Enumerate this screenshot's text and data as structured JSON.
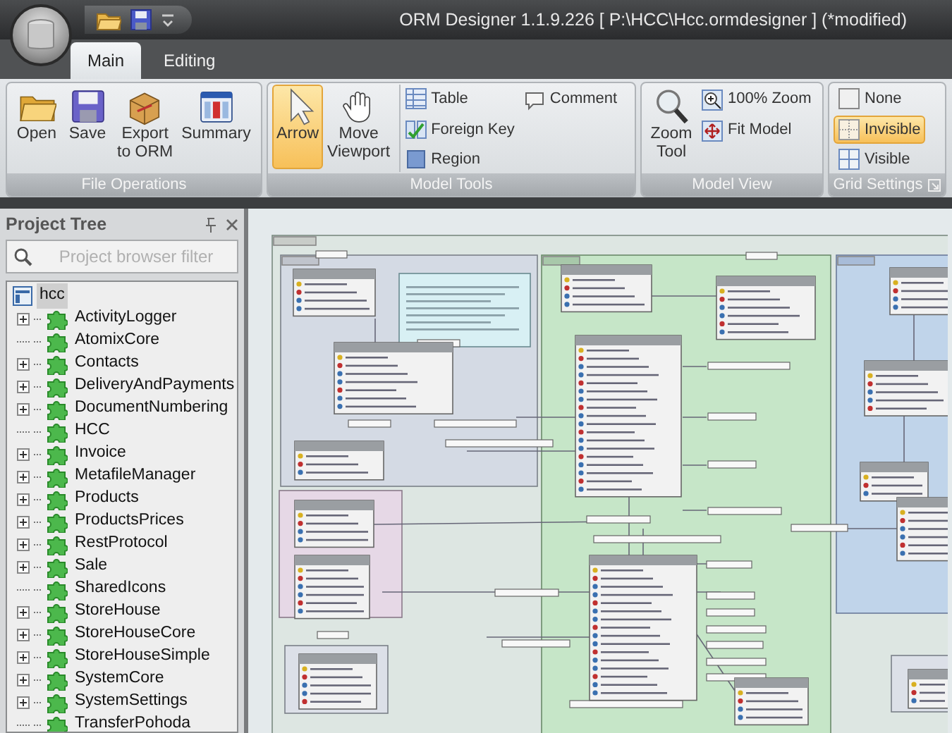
{
  "window": {
    "title": "ORM Designer 1.1.9.226 [ P:\\HCC\\Hcc.ormdesigner ] (*modified)"
  },
  "tabs": [
    {
      "label": "Main",
      "selected": true
    },
    {
      "label": "Editing",
      "selected": false
    }
  ],
  "ribbon_groups": [
    {
      "label": "File Operations",
      "columns": [
        [
          {
            "kind": "large",
            "label": "Open",
            "selected": false
          }
        ],
        [
          {
            "kind": "large",
            "label": "Save",
            "selected": false
          }
        ],
        [
          {
            "kind": "large",
            "label": "Export\nto ORM",
            "selected": false
          }
        ],
        [
          {
            "kind": "large",
            "label": "Summary",
            "selected": false
          }
        ]
      ]
    },
    {
      "label": "Model Tools",
      "columns": [
        [
          {
            "kind": "large",
            "label": "Arrow",
            "selected": true
          }
        ],
        [
          {
            "kind": "large",
            "label": "Move\nViewport",
            "selected": false
          }
        ],
        [
          {
            "kind": "small",
            "label": "Table",
            "selected": false
          },
          {
            "kind": "small",
            "label": "Foreign Key",
            "selected": false
          },
          {
            "kind": "small",
            "label": "Region",
            "selected": false
          }
        ],
        [
          {
            "kind": "small",
            "label": "Comment",
            "selected": false
          }
        ]
      ]
    },
    {
      "label": "Model View",
      "columns": [
        [
          {
            "kind": "large",
            "label": "Zoom\nTool",
            "selected": false
          }
        ],
        [
          {
            "kind": "small",
            "label": "100% Zoom",
            "selected": false
          },
          {
            "kind": "small",
            "label": "Fit Model",
            "selected": false
          }
        ]
      ]
    },
    {
      "label": "Grid Settings",
      "dialog_launcher": true,
      "columns": [
        [
          {
            "kind": "small",
            "label": "None",
            "selected": false
          },
          {
            "kind": "small",
            "label": "Invisible",
            "selected": true
          },
          {
            "kind": "small",
            "label": "Visible",
            "selected": false
          }
        ]
      ]
    }
  ],
  "project_tree": {
    "title": "Project Tree",
    "filter": {
      "placeholder": "Project browser filter"
    },
    "root": {
      "label": "hcc",
      "selected": true,
      "children": [
        {
          "label": "ActivityLogger",
          "expandable": true
        },
        {
          "label": "AtomixCore",
          "expandable": false
        },
        {
          "label": "Contacts",
          "expandable": true
        },
        {
          "label": "DeliveryAndPayments",
          "expandable": true
        },
        {
          "label": "DocumentNumbering",
          "expandable": true
        },
        {
          "label": "HCC",
          "expandable": false
        },
        {
          "label": "Invoice",
          "expandable": true
        },
        {
          "label": "MetafileManager",
          "expandable": true
        },
        {
          "label": "Products",
          "expandable": true
        },
        {
          "label": "ProductsPrices",
          "expandable": true
        },
        {
          "label": "RestProtocol",
          "expandable": true
        },
        {
          "label": "Sale",
          "expandable": true
        },
        {
          "label": "SharedIcons",
          "expandable": false
        },
        {
          "label": "StoreHouse",
          "expandable": true
        },
        {
          "label": "StoreHouseCore",
          "expandable": true
        },
        {
          "label": "StoreHouseSimple",
          "expandable": true
        },
        {
          "label": "SystemCore",
          "expandable": true
        },
        {
          "label": "SystemSettings",
          "expandable": true
        },
        {
          "label": "TransferPohoda",
          "expandable": false
        }
      ]
    }
  }
}
